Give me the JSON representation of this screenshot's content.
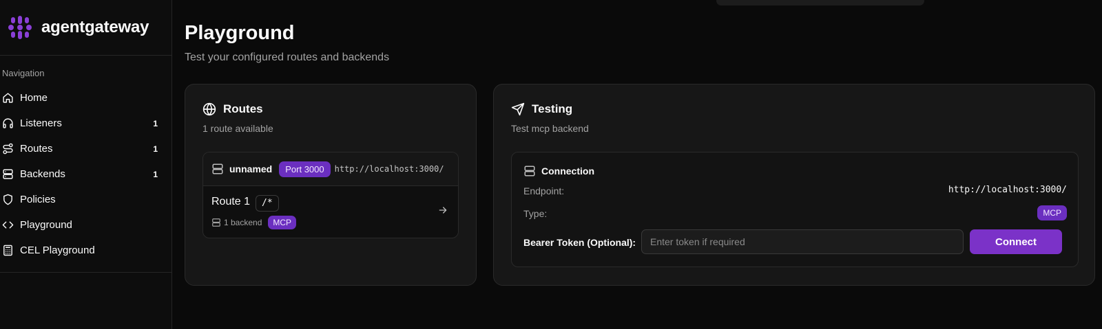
{
  "app": {
    "name": "agentgateway"
  },
  "sidebar": {
    "caption": "Navigation",
    "items": [
      {
        "label": "Home",
        "icon": "home-icon"
      },
      {
        "label": "Listeners",
        "icon": "headphones-icon",
        "count": "1"
      },
      {
        "label": "Routes",
        "icon": "route-icon",
        "count": "1"
      },
      {
        "label": "Backends",
        "icon": "server-icon",
        "count": "1"
      },
      {
        "label": "Policies",
        "icon": "shield-icon"
      },
      {
        "label": "Playground",
        "icon": "code-icon"
      },
      {
        "label": "CEL Playground",
        "icon": "calculator-icon"
      }
    ]
  },
  "page": {
    "title": "Playground",
    "subtitle": "Test your configured routes and backends"
  },
  "routes_card": {
    "title": "Routes",
    "subtitle": "1 route available",
    "listener": {
      "name": "unnamed",
      "port_label": "Port 3000",
      "url": "http://localhost:3000/"
    },
    "route": {
      "name": "Route 1",
      "path": "/*",
      "backend_count": "1 backend",
      "backend_type": "MCP"
    }
  },
  "testing_card": {
    "title": "Testing",
    "subtitle": "Test mcp backend",
    "connection": {
      "title": "Connection",
      "endpoint_label": "Endpoint:",
      "endpoint_value": "http://localhost:3000/",
      "type_label": "Type:",
      "type_value": "MCP",
      "token_label": "Bearer Token (Optional):",
      "token_value": "",
      "token_placeholder": "Enter token if required",
      "connect_label": "Connect"
    }
  },
  "colors": {
    "background": "#0a0a0a",
    "card": "#171717",
    "accent": "#7b32c8",
    "pill": "#6b2fc0",
    "muted_text": "#a3a3a3"
  }
}
